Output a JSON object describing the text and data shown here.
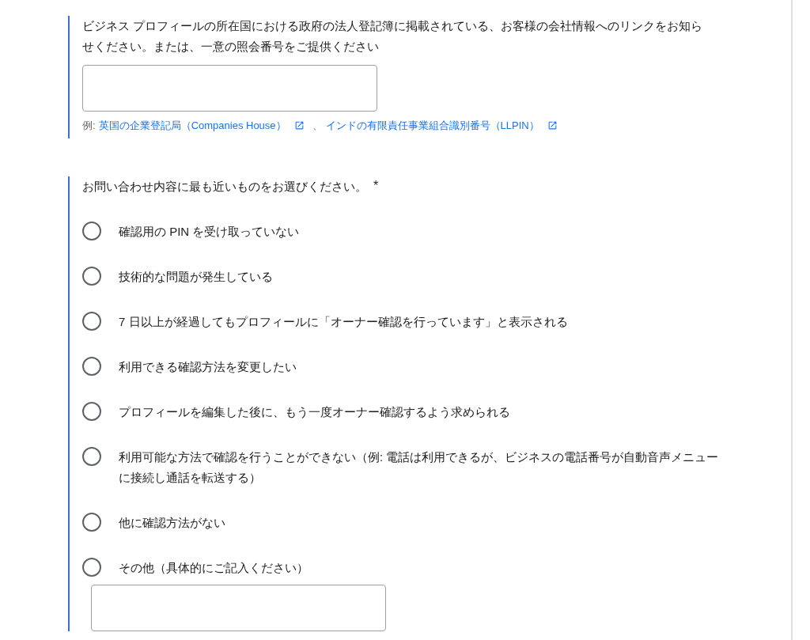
{
  "sections": [
    {
      "kind": "text",
      "question": "ビジネス プロフィールの所在国における政府の法人登記簿に掲載されている、お客様の会社情報へのリンクをお知らせください。または、一意の照会番号をご提供ください",
      "hint": {
        "prefix": "例:",
        "separator": "、",
        "links": [
          {
            "label": "英国の企業登記局（Companies House）"
          },
          {
            "label": "インドの有限責任事業組合識別番号（LLPIN）"
          }
        ]
      }
    },
    {
      "kind": "radio",
      "question": "お問い合わせ内容に最も近いものをお選びください。",
      "required_mark": "*",
      "options": [
        {
          "kind": "choice",
          "label": "確認用の PIN を受け取っていない",
          "selected": false
        },
        {
          "kind": "choice",
          "label": "技術的な問題が発生している",
          "selected": false
        },
        {
          "kind": "choice",
          "label": "7 日以上が経過してもプロフィールに「オーナー確認を行っています」と表示される",
          "selected": false
        },
        {
          "kind": "choice",
          "label": "利用できる確認方法を変更したい",
          "selected": false
        },
        {
          "kind": "choice",
          "label": "プロフィールを編集した後に、もう一度オーナー確認するよう求められる",
          "selected": false
        },
        {
          "kind": "choice",
          "label": "利用可能な方法で確認を行うことができない（例: 電話は利用できるが、ビジネスの電話番号が自動音声メニューに接続し通話を転送する）",
          "selected": false
        },
        {
          "kind": "choice",
          "label": "他に確認方法がない",
          "selected": false
        },
        {
          "kind": "other",
          "label": "その他（具体的にご記入ください）",
          "selected": false
        }
      ]
    }
  ]
}
